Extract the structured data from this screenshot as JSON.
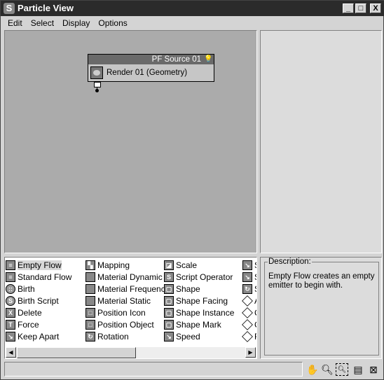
{
  "window": {
    "title": "Particle View",
    "minimize": "_",
    "maximize": "□",
    "close": "X"
  },
  "menu": [
    "Edit",
    "Select",
    "Display",
    "Options"
  ],
  "graph": {
    "node": {
      "title": "PF Source 01",
      "operator": "Render 01 (Geometry)"
    }
  },
  "depot": {
    "columns": [
      [
        {
          "label": "Empty Flow",
          "icon": "flow-icon",
          "selected": true
        },
        {
          "label": "Standard Flow",
          "icon": "flow-icon"
        },
        {
          "label": "Birth",
          "icon": "birth-icon"
        },
        {
          "label": "Birth Script",
          "icon": "script-icon"
        },
        {
          "label": "Delete",
          "icon": "delete-icon"
        },
        {
          "label": "Force",
          "icon": "force-icon"
        },
        {
          "label": "Keep Apart",
          "icon": "operator-icon"
        }
      ],
      [
        {
          "label": "Mapping",
          "icon": "mapping-icon"
        },
        {
          "label": "Material Dynamic",
          "icon": "material-icon"
        },
        {
          "label": "Material Frequency",
          "icon": "material-icon"
        },
        {
          "label": "Material Static",
          "icon": "material-icon"
        },
        {
          "label": "Position Icon",
          "icon": "position-icon"
        },
        {
          "label": "Position Object",
          "icon": "position-icon"
        },
        {
          "label": "Rotation",
          "icon": "rotation-icon"
        }
      ],
      [
        {
          "label": "Scale",
          "icon": "scale-icon"
        },
        {
          "label": "Script Operator",
          "icon": "script-icon"
        },
        {
          "label": "Shape",
          "icon": "shape-icon"
        },
        {
          "label": "Shape Facing",
          "icon": "shape-icon"
        },
        {
          "label": "Shape Instance",
          "icon": "shape-icon"
        },
        {
          "label": "Shape Mark",
          "icon": "shape-icon"
        },
        {
          "label": "Speed",
          "icon": "operator-icon"
        }
      ],
      [
        {
          "label": "S",
          "icon": "operator-icon"
        },
        {
          "label": "S",
          "icon": "operator-icon"
        },
        {
          "label": "S",
          "icon": "rotation-icon"
        },
        {
          "label": "A",
          "icon": "test-icon"
        },
        {
          "label": "C",
          "icon": "test-icon"
        },
        {
          "label": "C",
          "icon": "test-icon"
        },
        {
          "label": "F",
          "icon": "test-icon"
        }
      ]
    ]
  },
  "description": {
    "label": "Description:",
    "text": "Empty Flow creates an empty emitter to begin with."
  },
  "tools": [
    "pan-icon",
    "zoom-icon",
    "zoom-region-icon",
    "zoom-extents-icon",
    "no-zoom-icon"
  ]
}
